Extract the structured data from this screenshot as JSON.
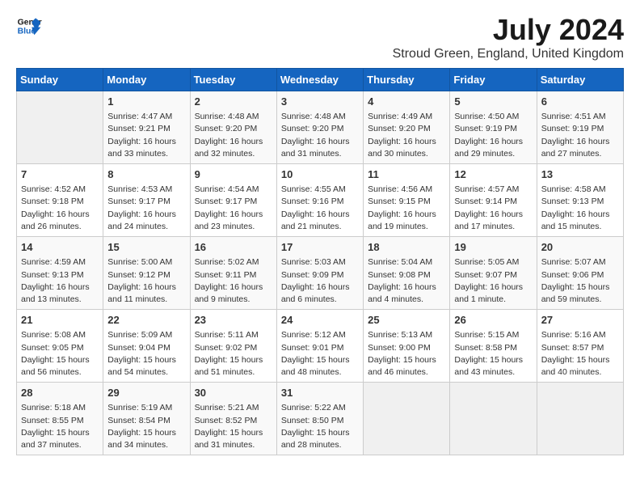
{
  "logo": {
    "line1": "General",
    "line2": "Blue"
  },
  "title": "July 2024",
  "location": "Stroud Green, England, United Kingdom",
  "headers": [
    "Sunday",
    "Monday",
    "Tuesday",
    "Wednesday",
    "Thursday",
    "Friday",
    "Saturday"
  ],
  "weeks": [
    [
      {
        "day": "",
        "info": ""
      },
      {
        "day": "1",
        "info": "Sunrise: 4:47 AM\nSunset: 9:21 PM\nDaylight: 16 hours\nand 33 minutes."
      },
      {
        "day": "2",
        "info": "Sunrise: 4:48 AM\nSunset: 9:20 PM\nDaylight: 16 hours\nand 32 minutes."
      },
      {
        "day": "3",
        "info": "Sunrise: 4:48 AM\nSunset: 9:20 PM\nDaylight: 16 hours\nand 31 minutes."
      },
      {
        "day": "4",
        "info": "Sunrise: 4:49 AM\nSunset: 9:20 PM\nDaylight: 16 hours\nand 30 minutes."
      },
      {
        "day": "5",
        "info": "Sunrise: 4:50 AM\nSunset: 9:19 PM\nDaylight: 16 hours\nand 29 minutes."
      },
      {
        "day": "6",
        "info": "Sunrise: 4:51 AM\nSunset: 9:19 PM\nDaylight: 16 hours\nand 27 minutes."
      }
    ],
    [
      {
        "day": "7",
        "info": "Sunrise: 4:52 AM\nSunset: 9:18 PM\nDaylight: 16 hours\nand 26 minutes."
      },
      {
        "day": "8",
        "info": "Sunrise: 4:53 AM\nSunset: 9:17 PM\nDaylight: 16 hours\nand 24 minutes."
      },
      {
        "day": "9",
        "info": "Sunrise: 4:54 AM\nSunset: 9:17 PM\nDaylight: 16 hours\nand 23 minutes."
      },
      {
        "day": "10",
        "info": "Sunrise: 4:55 AM\nSunset: 9:16 PM\nDaylight: 16 hours\nand 21 minutes."
      },
      {
        "day": "11",
        "info": "Sunrise: 4:56 AM\nSunset: 9:15 PM\nDaylight: 16 hours\nand 19 minutes."
      },
      {
        "day": "12",
        "info": "Sunrise: 4:57 AM\nSunset: 9:14 PM\nDaylight: 16 hours\nand 17 minutes."
      },
      {
        "day": "13",
        "info": "Sunrise: 4:58 AM\nSunset: 9:13 PM\nDaylight: 16 hours\nand 15 minutes."
      }
    ],
    [
      {
        "day": "14",
        "info": "Sunrise: 4:59 AM\nSunset: 9:13 PM\nDaylight: 16 hours\nand 13 minutes."
      },
      {
        "day": "15",
        "info": "Sunrise: 5:00 AM\nSunset: 9:12 PM\nDaylight: 16 hours\nand 11 minutes."
      },
      {
        "day": "16",
        "info": "Sunrise: 5:02 AM\nSunset: 9:11 PM\nDaylight: 16 hours\nand 9 minutes."
      },
      {
        "day": "17",
        "info": "Sunrise: 5:03 AM\nSunset: 9:09 PM\nDaylight: 16 hours\nand 6 minutes."
      },
      {
        "day": "18",
        "info": "Sunrise: 5:04 AM\nSunset: 9:08 PM\nDaylight: 16 hours\nand 4 minutes."
      },
      {
        "day": "19",
        "info": "Sunrise: 5:05 AM\nSunset: 9:07 PM\nDaylight: 16 hours\nand 1 minute."
      },
      {
        "day": "20",
        "info": "Sunrise: 5:07 AM\nSunset: 9:06 PM\nDaylight: 15 hours\nand 59 minutes."
      }
    ],
    [
      {
        "day": "21",
        "info": "Sunrise: 5:08 AM\nSunset: 9:05 PM\nDaylight: 15 hours\nand 56 minutes."
      },
      {
        "day": "22",
        "info": "Sunrise: 5:09 AM\nSunset: 9:04 PM\nDaylight: 15 hours\nand 54 minutes."
      },
      {
        "day": "23",
        "info": "Sunrise: 5:11 AM\nSunset: 9:02 PM\nDaylight: 15 hours\nand 51 minutes."
      },
      {
        "day": "24",
        "info": "Sunrise: 5:12 AM\nSunset: 9:01 PM\nDaylight: 15 hours\nand 48 minutes."
      },
      {
        "day": "25",
        "info": "Sunrise: 5:13 AM\nSunset: 9:00 PM\nDaylight: 15 hours\nand 46 minutes."
      },
      {
        "day": "26",
        "info": "Sunrise: 5:15 AM\nSunset: 8:58 PM\nDaylight: 15 hours\nand 43 minutes."
      },
      {
        "day": "27",
        "info": "Sunrise: 5:16 AM\nSunset: 8:57 PM\nDaylight: 15 hours\nand 40 minutes."
      }
    ],
    [
      {
        "day": "28",
        "info": "Sunrise: 5:18 AM\nSunset: 8:55 PM\nDaylight: 15 hours\nand 37 minutes."
      },
      {
        "day": "29",
        "info": "Sunrise: 5:19 AM\nSunset: 8:54 PM\nDaylight: 15 hours\nand 34 minutes."
      },
      {
        "day": "30",
        "info": "Sunrise: 5:21 AM\nSunset: 8:52 PM\nDaylight: 15 hours\nand 31 minutes."
      },
      {
        "day": "31",
        "info": "Sunrise: 5:22 AM\nSunset: 8:50 PM\nDaylight: 15 hours\nand 28 minutes."
      },
      {
        "day": "",
        "info": ""
      },
      {
        "day": "",
        "info": ""
      },
      {
        "day": "",
        "info": ""
      }
    ]
  ]
}
